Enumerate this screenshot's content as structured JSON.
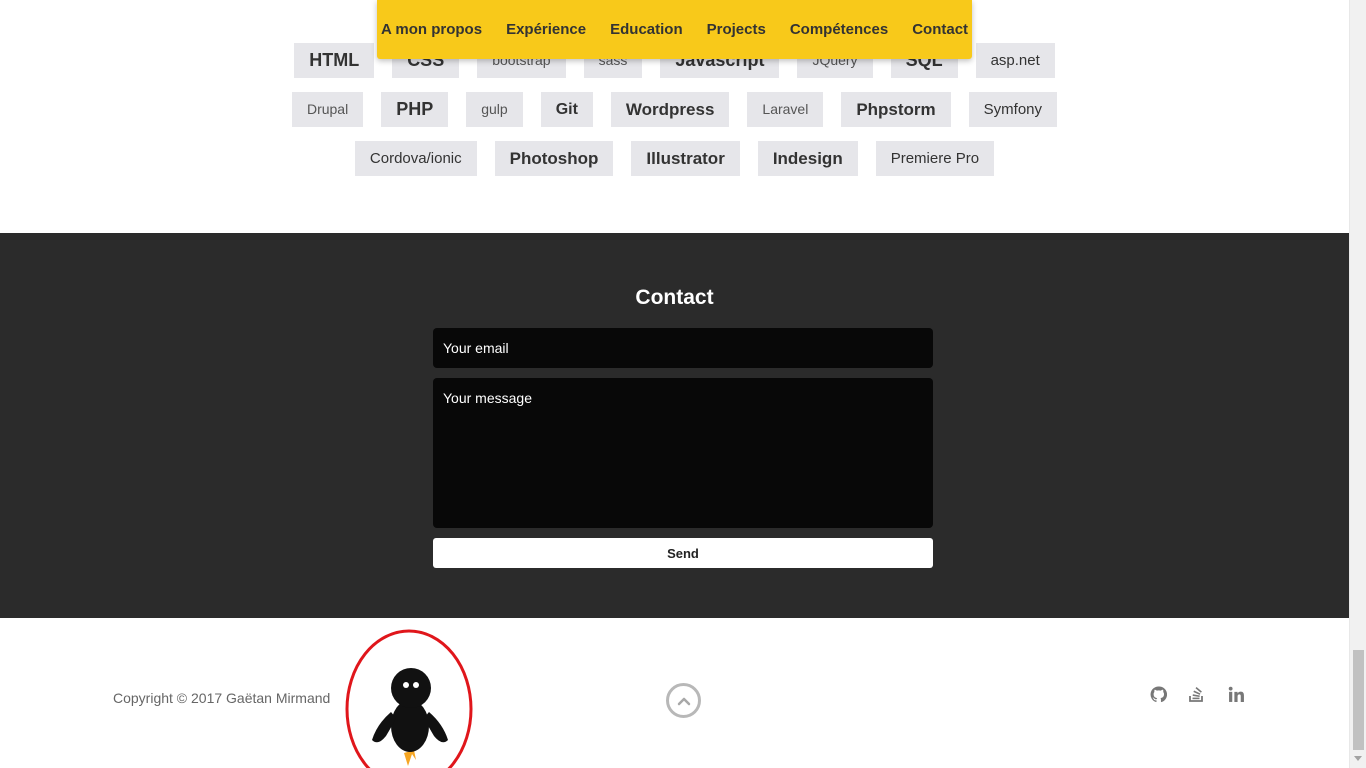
{
  "nav": {
    "items": [
      "A mon propos",
      "Expérience",
      "Education",
      "Projects",
      "Compétences",
      "Contact"
    ]
  },
  "skills": {
    "rows": [
      [
        {
          "label": "HTML",
          "size": 5
        },
        {
          "label": "CSS",
          "size": 5
        },
        {
          "label": "bootstrap",
          "size": 1
        },
        {
          "label": "sass",
          "size": 1
        },
        {
          "label": "Javascript",
          "size": 5
        },
        {
          "label": "JQuery",
          "size": 1
        },
        {
          "label": "SQL",
          "size": 5
        },
        {
          "label": "asp.net",
          "size": 2
        }
      ],
      [
        {
          "label": "Drupal",
          "size": 1
        },
        {
          "label": "PHP",
          "size": 5
        },
        {
          "label": "gulp",
          "size": 1
        },
        {
          "label": "Git",
          "size": 3
        },
        {
          "label": "Wordpress",
          "size": 4
        },
        {
          "label": "Laravel",
          "size": 1
        },
        {
          "label": "Phpstorm",
          "size": 4
        },
        {
          "label": "Symfony",
          "size": 2
        }
      ],
      [
        {
          "label": "Cordova/ionic",
          "size": 2
        },
        {
          "label": "Photoshop",
          "size": 4
        },
        {
          "label": "Illustrator",
          "size": 4
        },
        {
          "label": "Indesign",
          "size": 4
        },
        {
          "label": "Premiere Pro",
          "size": 2
        }
      ]
    ]
  },
  "contact": {
    "title": "Contact",
    "email_placeholder": "Your email",
    "message_placeholder": "Your message",
    "send_label": "Send"
  },
  "footer": {
    "copyright": "Copyright © 2017 Gaëtan Mirmand",
    "social": [
      "github-icon",
      "stackoverflow-icon",
      "linkedin-icon"
    ]
  },
  "colors": {
    "accent": "#f8c91a",
    "contact_bg": "#2b2b2b",
    "field_bg": "#080808",
    "tag_bg": "#e6e6ea",
    "highlight_circle": "#e0161b"
  }
}
